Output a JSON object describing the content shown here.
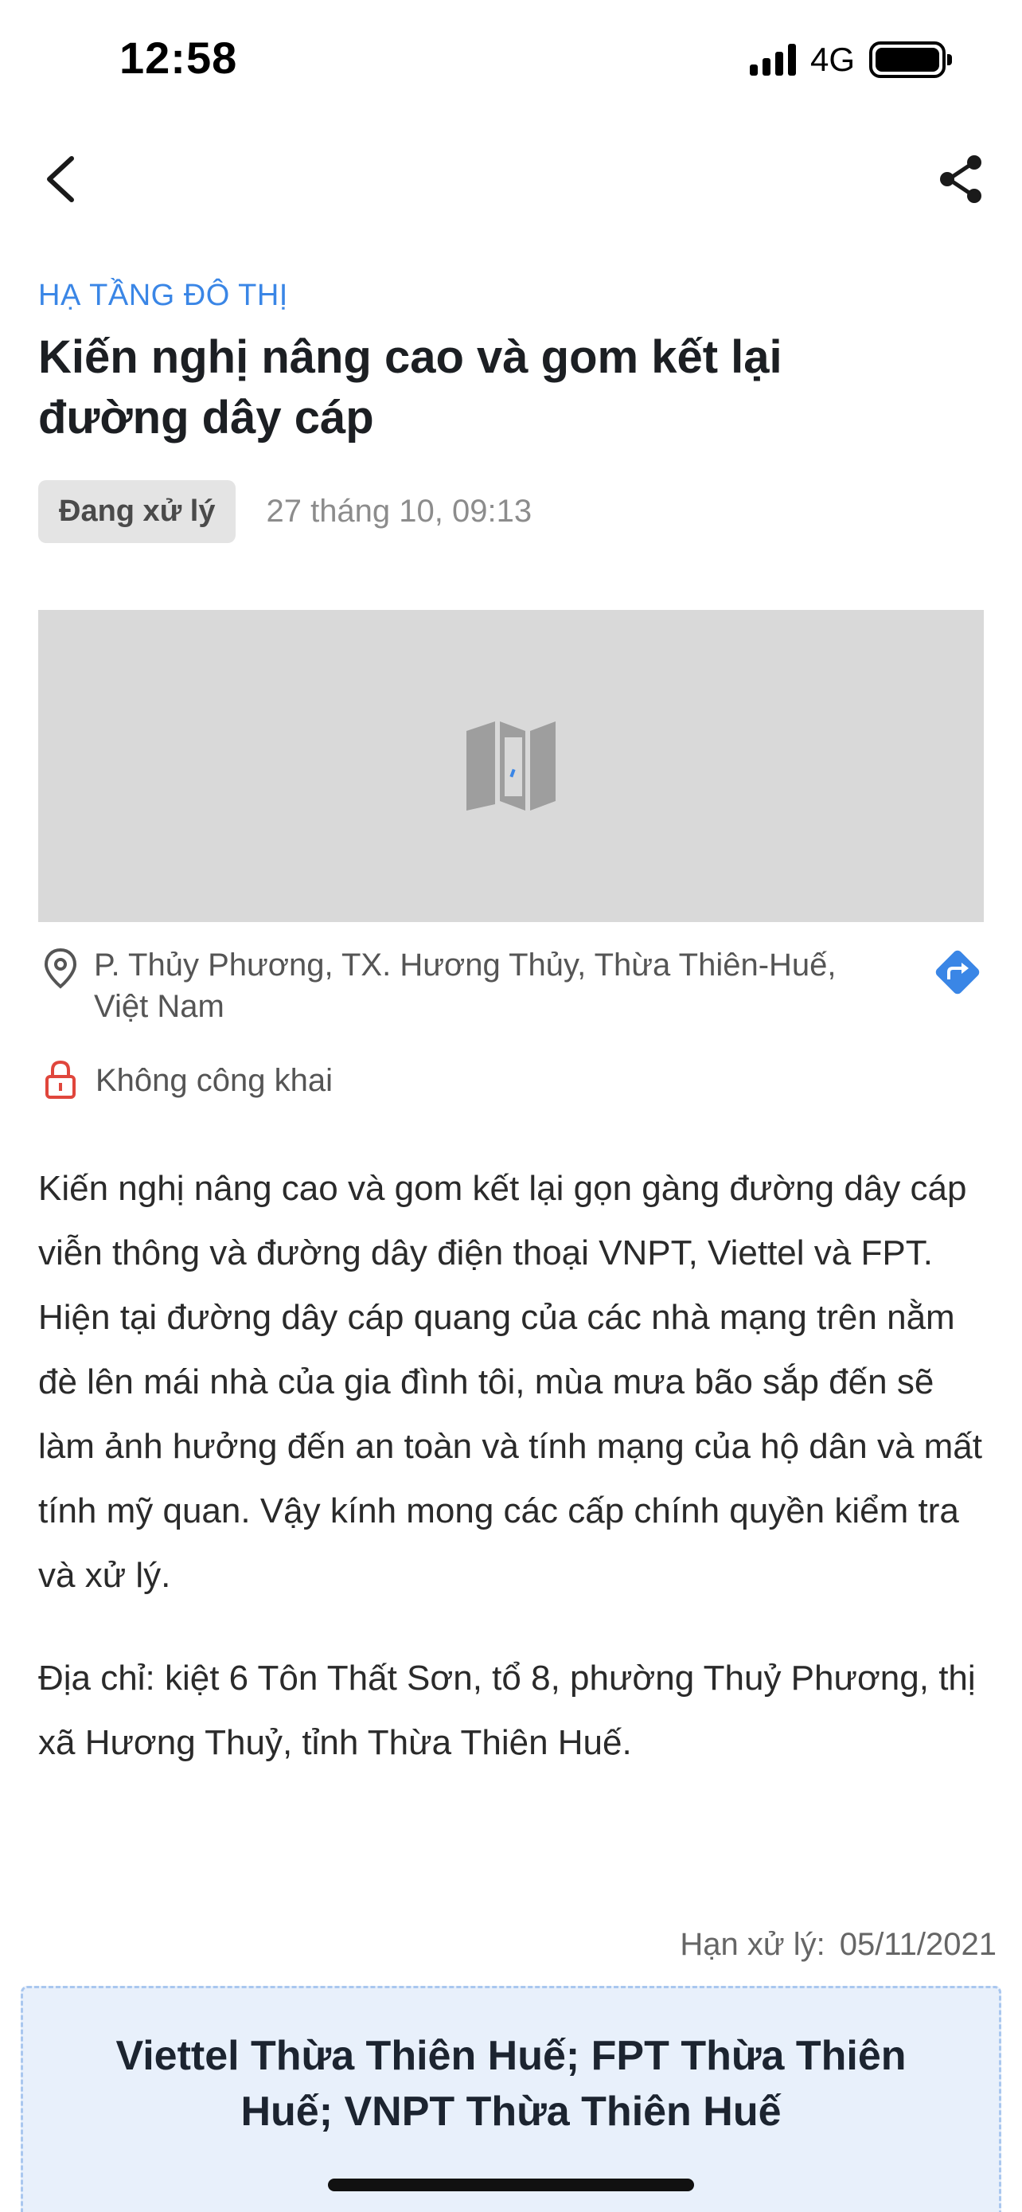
{
  "status_bar": {
    "time": "12:58",
    "network": "4G"
  },
  "nav": {
    "back_icon": "chevron-left-icon",
    "share_icon": "share-icon"
  },
  "article": {
    "category": "HẠ TẦNG ĐÔ THỊ",
    "title": "Kiến nghị nâng cao và gom kết lại đường dây cáp",
    "status": "Đang xử lý",
    "date": "27 tháng 10, 09:13",
    "location": "P. Thủy Phương, TX. Hương Thủy, Thừa Thiên-Huế, Việt Nam",
    "privacy": "Không công khai",
    "description": "Kiến nghị nâng cao và gom kết lại gọn gàng đường dây cáp viễn thông và đường dây điện thoại VNPT, Viettel và FPT. Hiện tại đường dây cáp quang của các nhà mạng trên nằm đè lên mái nhà của gia đình tôi, mùa mưa bão sắp đến sẽ làm ảnh hưởng đến an toàn và tính mạng của hộ dân và mất tính mỹ quan. Vậy kính mong các cấp chính quyền kiểm tra và xử lý.",
    "address": "Địa chỉ: kiệt 6 Tôn Thất Sơn, tổ 8, phường Thuỷ Phương, thị xã Hương Thuỷ, tỉnh Thừa Thiên Huế.",
    "deadline_label": "Hạn xử lý:",
    "deadline_value": "05/11/2021",
    "assigned_units": "Viettel Thừa Thiên Huế; FPT Thừa Thiên Huế; VNPT Thừa Thiên Huế"
  },
  "colors": {
    "accent": "#3a86e6",
    "badge_bg": "#e4e4e4",
    "lock": "#e0463c",
    "units_bg": "#e8f0fb"
  }
}
